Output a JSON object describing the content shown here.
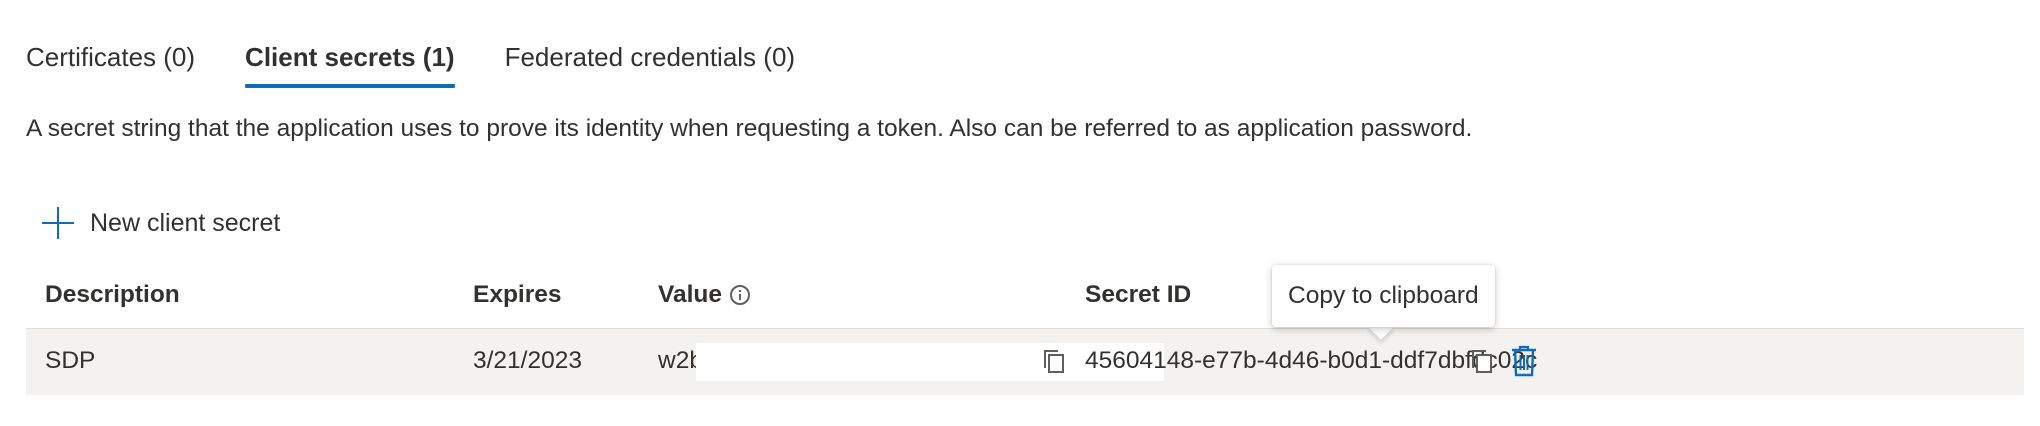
{
  "tabs": [
    {
      "label": "Certificates (0)",
      "active": false
    },
    {
      "label": "Client secrets (1)",
      "active": true
    },
    {
      "label": "Federated credentials (0)",
      "active": false
    }
  ],
  "description": "A secret string that the application uses to prove its identity when requesting a token. Also can be referred to as application password.",
  "new_secret_button": {
    "label": "New client secret",
    "icon": "plus-icon"
  },
  "table": {
    "columns": [
      "Description",
      "Expires",
      "Value",
      "Secret ID"
    ],
    "value_info_icon": "info-icon",
    "rows": [
      {
        "description": "SDP",
        "expires": "3/21/2023",
        "value_visible": "w2b",
        "secret_id": "45604148-e77b-4d46-b0d1-ddf7dbfdc02c"
      }
    ]
  },
  "tooltip": {
    "text": "Copy to clipboard"
  },
  "colors": {
    "accent": "#0f6cbd",
    "row_background": "#f3f2f1",
    "text": "#323130"
  }
}
